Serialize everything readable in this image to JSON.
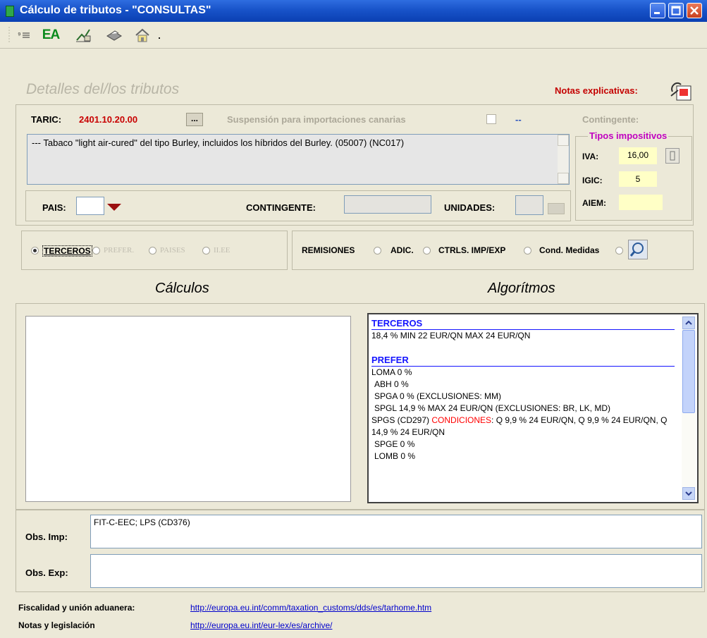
{
  "window": {
    "title": "Cálculo de tributos  -  \"CONSULTAS\""
  },
  "toolbar": {
    "ea_label": "EA",
    "dropdown_glyph": "."
  },
  "panel": {
    "title": "Detalles del/los tributos",
    "notas_label": "Notas explicativas:"
  },
  "taric": {
    "label": "TARIC:",
    "value": "2401.10.20.00",
    "dots": "...",
    "suspension_label": "Suspensión para importaciones canarias",
    "suspension_dash": "--",
    "contingente_label": "Contingente:",
    "description": "--- Tabaco \"light air-cured\" del tipo Burley, incluidos los híbridos del Burley. (05007) (NC017)"
  },
  "tipos": {
    "legend": "Tipos impositivos",
    "iva_label": "IVA:",
    "iva_value": "16,00",
    "igic_label": "IGIC:",
    "igic_value": "5",
    "aiem_label": "AIEM:",
    "aiem_value": ""
  },
  "pais_row": {
    "pais_label": "PAIS:",
    "contingente_label": "CONTINGENTE:",
    "unidades_label": "UNIDADES:"
  },
  "radios_left": [
    {
      "label": "TERCEROS",
      "selected": true
    },
    {
      "label": "PREFER.",
      "selected": false
    },
    {
      "label": "PAISES",
      "selected": false
    },
    {
      "label": "II.EE",
      "selected": false
    }
  ],
  "radios_right": [
    {
      "label": "REMISIONES"
    },
    {
      "label": "ADIC."
    },
    {
      "label": "CTRLS. IMP/EXP"
    },
    {
      "label": "Cond. Medidas"
    }
  ],
  "sections": {
    "calculos": "Cálculos",
    "algoritmos": "Algorítmos"
  },
  "algoritmos": {
    "terceros_header": "TERCEROS",
    "terceros_lines": [
      "18,4 % MIN 22 EUR/QN MAX 24 EUR/QN"
    ],
    "prefer_header": "PREFER",
    "prefer_lines": [
      "LOMA 0 %",
      "ABH 0 %",
      "SPGA 0 % (EXCLUSIONES: MM)",
      "SPGL 14,9 % MAX 24 EUR/QN (EXCLUSIONES: BR, LK, MD)"
    ],
    "spgs_prefix": "SPGS (CD297) ",
    "spgs_condiciones": "CONDICIONES",
    "spgs_rest": ": Q 9,9 % 24 EUR/QN, Q 9,9 % 24 EUR/QN, Q 14,9 % 24 EUR/QN",
    "tail_lines": [
      "SPGE 0 %",
      "LOMB 0 %"
    ]
  },
  "obs": {
    "imp_label": "Obs. Imp:",
    "imp_value": "FIT-C-EEC; LPS (CD376)",
    "exp_label": "Obs. Exp:",
    "exp_value": ""
  },
  "footer": {
    "fiscalidad_label": "Fiscalidad y unión aduanera:",
    "fiscalidad_url": "http://europa.eu.int/comm/taxation_customs/dds/es/tarhome.htm",
    "notas_label": "Notas y legislación",
    "notas_url": "http://europa.eu.int/eur-lex/es/archive/"
  }
}
